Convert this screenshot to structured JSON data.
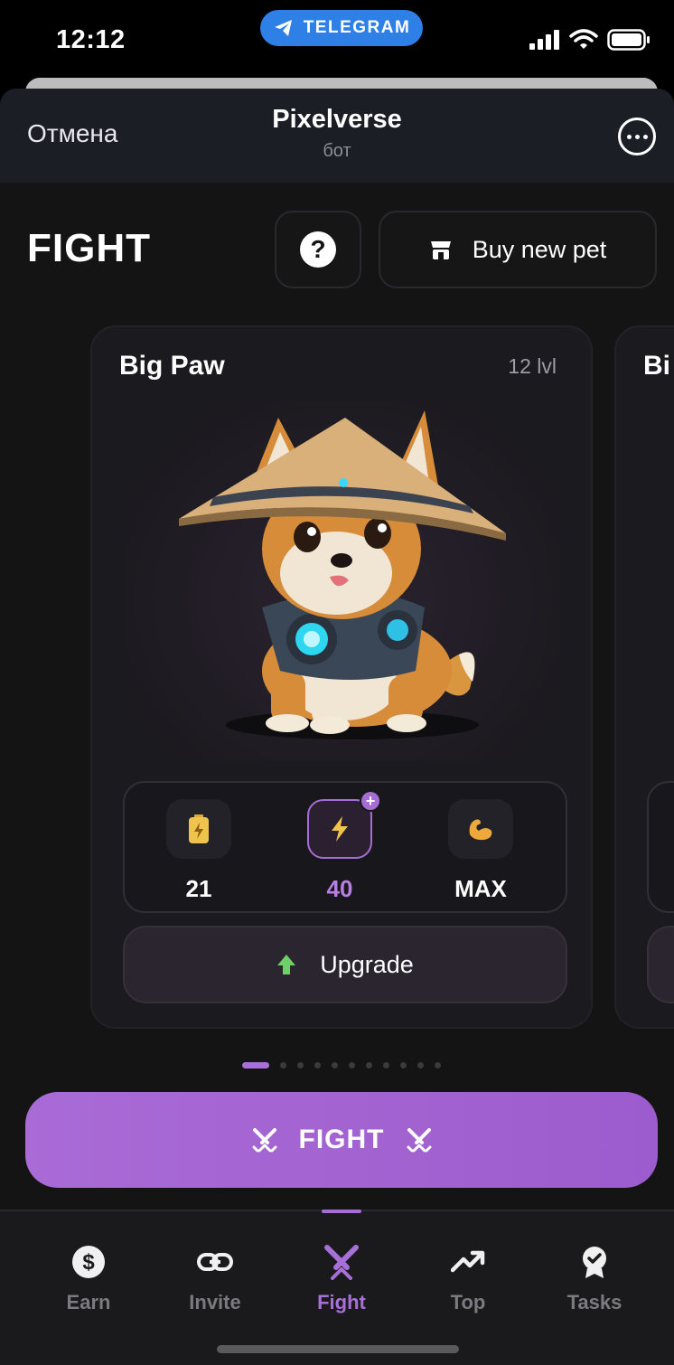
{
  "status": {
    "time": "12:12",
    "pill_label": "TELEGRAM"
  },
  "header": {
    "cancel_label": "Отмена",
    "title": "Pixelverse",
    "subtitle": "бот"
  },
  "page": {
    "title": "FIGHT",
    "help_label": "?",
    "buy_label": "Buy new pet"
  },
  "pet": {
    "name": "Big Paw",
    "level": "12 lvl",
    "next_name": "Bi",
    "stats": [
      {
        "icon": "battery-icon",
        "value": "21"
      },
      {
        "icon": "lightning-icon",
        "value": "40",
        "badge": "+"
      },
      {
        "icon": "muscle-icon",
        "value": "MAX"
      }
    ],
    "upgrade_label": "Upgrade"
  },
  "pager": {
    "total": 11,
    "active": 0
  },
  "fight_button": {
    "label": "FIGHT"
  },
  "tabs": [
    {
      "label": "Earn",
      "icon": "dollar-icon"
    },
    {
      "label": "Invite",
      "icon": "link-icon"
    },
    {
      "label": "Fight",
      "icon": "swords-icon",
      "active": true
    },
    {
      "label": "Top",
      "icon": "trend-up-icon"
    },
    {
      "label": "Tasks",
      "icon": "badge-icon"
    }
  ],
  "colors": {
    "accent": "#a66dd4",
    "background": "#141414",
    "header": "#1c1e26",
    "telegram": "#2f80e6"
  }
}
